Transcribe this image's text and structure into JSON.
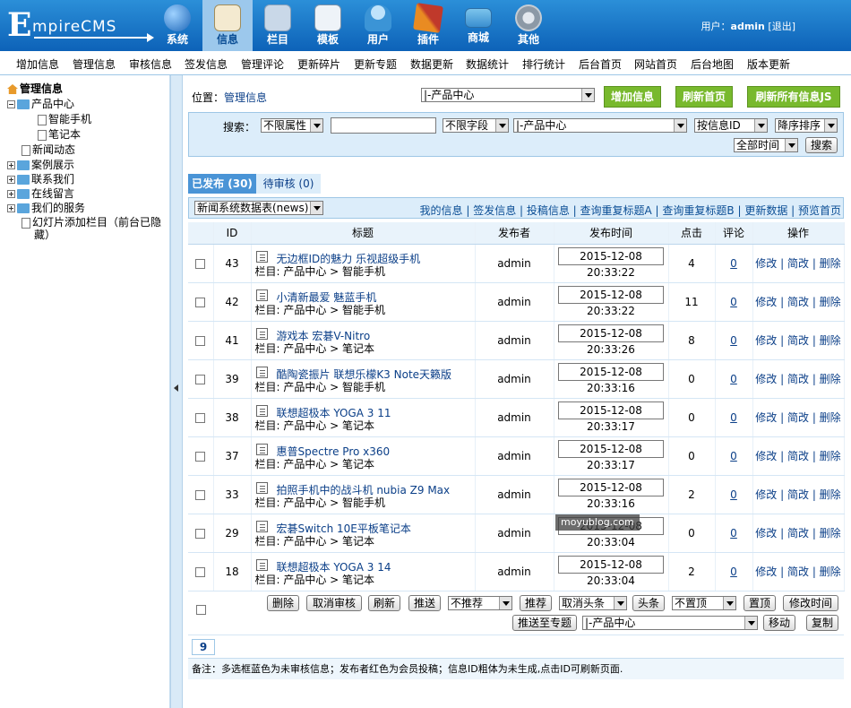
{
  "header": {
    "logo_big": "E",
    "logo_small": "mpireCMS",
    "nav": [
      {
        "label": "系统",
        "icon": "globe-icon",
        "color": "#3a86d0"
      },
      {
        "label": "信息",
        "icon": "edit-icon",
        "color": "#f1e3b8",
        "active": true
      },
      {
        "label": "栏目",
        "icon": "folder-icon",
        "color": "#c7d7e8"
      },
      {
        "label": "模板",
        "icon": "window-icon",
        "color": "#e7eef6"
      },
      {
        "label": "用户",
        "icon": "user-icon",
        "color": "#5fa9df"
      },
      {
        "label": "插件",
        "icon": "tools-icon",
        "color": "#e68a1f"
      },
      {
        "label": "商城",
        "icon": "card-icon",
        "color": "#6ab8e5"
      },
      {
        "label": "其他",
        "icon": "gear-icon",
        "color": "#b9c4cf"
      }
    ],
    "user_prefix": "用户：",
    "user_name": "admin",
    "logout": "[退出]"
  },
  "menubar": [
    "增加信息",
    "管理信息",
    "审核信息",
    "签发信息",
    "管理评论",
    "更新碎片",
    "更新专题",
    "数据更新",
    "数据统计",
    "排行统计",
    "后台首页",
    "网站首页",
    "后台地图",
    "版本更新"
  ],
  "sidebar": {
    "root": "管理信息",
    "product": "产品中心",
    "phone": "智能手机",
    "laptop": "笔记本",
    "news": "新闻动态",
    "cases": "案例展示",
    "contact": "联系我们",
    "message": "在线留言",
    "service": "我们的服务",
    "slide1": "幻灯片添加栏目（前台已隐",
    "slide2": "藏）"
  },
  "location": {
    "label": "位置：",
    "value": "管理信息"
  },
  "category_select": "|-产品中心",
  "buttons": {
    "add": "增加信息",
    "refresh_home": "刷新首页",
    "refresh_all": "刷新所有信息JS"
  },
  "search": {
    "label": "搜索：",
    "attr": "不限属性",
    "field": "不限字段",
    "cat": "|-产品中心",
    "order_by": "按信息ID",
    "order": "降序排序",
    "time": "全部时间",
    "go": "搜索"
  },
  "tabs": {
    "published": "已发布 (30)",
    "pending": "待审核 (0)"
  },
  "table_select": "新闻系统数据表(news)",
  "list_links": "我的信息 | 签发信息 | 投稿信息 | 查询重复标题A | 查询重复标题B | 更新数据 | 预览首页",
  "columns": {
    "id": "ID",
    "title": "标题",
    "author": "发布者",
    "time": "发布时间",
    "hits": "点击",
    "comments": "评论",
    "ops": "操作"
  },
  "rows": [
    {
      "id": "43",
      "title": "无边框ID的魅力 乐视超级手机",
      "cat": "栏目: 产品中心 > 智能手机",
      "author": "admin",
      "time": "2015-12-08 20:33:22",
      "hits": "4",
      "comments": "0"
    },
    {
      "id": "42",
      "title": "小清新最爱 魅蓝手机",
      "cat": "栏目: 产品中心 > 智能手机",
      "author": "admin",
      "time": "2015-12-08 20:33:22",
      "hits": "11",
      "comments": "0"
    },
    {
      "id": "41",
      "title": "游戏本 宏碁V-Nitro",
      "cat": "栏目: 产品中心 > 笔记本",
      "author": "admin",
      "time": "2015-12-08 20:33:26",
      "hits": "8",
      "comments": "0"
    },
    {
      "id": "39",
      "title": "酷陶瓷振片 联想乐檬K3 Note天籁版",
      "cat": "栏目: 产品中心 > 智能手机",
      "author": "admin",
      "time": "2015-12-08 20:33:16",
      "hits": "0",
      "comments": "0"
    },
    {
      "id": "38",
      "title": "联想超极本 YOGA 3 11",
      "cat": "栏目: 产品中心 > 笔记本",
      "author": "admin",
      "time": "2015-12-08 20:33:17",
      "hits": "0",
      "comments": "0"
    },
    {
      "id": "37",
      "title": "惠普Spectre Pro x360",
      "cat": "栏目: 产品中心 > 笔记本",
      "author": "admin",
      "time": "2015-12-08 20:33:17",
      "hits": "0",
      "comments": "0"
    },
    {
      "id": "33",
      "title": "拍照手机中的战斗机 nubia Z9 Max",
      "cat": "栏目: 产品中心 > 智能手机",
      "author": "admin",
      "time": "2015-12-08 20:33:16",
      "hits": "2",
      "comments": "0"
    },
    {
      "id": "29",
      "title": "宏碁Switch 10E平板笔记本",
      "cat": "栏目: 产品中心 > 笔记本",
      "author": "admin",
      "time": "2015-12-08 20:33:04",
      "hits": "0",
      "comments": "0"
    },
    {
      "id": "18",
      "title": "联想超极本 YOGA 3 14",
      "cat": "栏目: 产品中心 > 笔记本",
      "author": "admin",
      "time": "2015-12-08 20:33:04",
      "hits": "2",
      "comments": "0"
    }
  ],
  "ops": {
    "edit": "修改",
    "simple": "简改",
    "del": "删除"
  },
  "bottom": {
    "delete": "删除",
    "unaudit": "取消审核",
    "refresh": "刷新",
    "push": "推送",
    "recommend_sel": "不推荐",
    "recommend": "推荐",
    "headline_sel": "取消头条",
    "headline": "头条",
    "top_sel": "不置顶",
    "top": "置顶",
    "modtime": "修改时间",
    "push_topic": "推送至专题",
    "move_cat": "|-产品中心",
    "move": "移动",
    "copy": "复制"
  },
  "page_num": "9",
  "watermark": "moyublog.com",
  "remark": "备注：多选框蓝色为未审核信息；发布者红色为会员投稿；信息ID粗体为未生成,点击ID可刷新页面."
}
